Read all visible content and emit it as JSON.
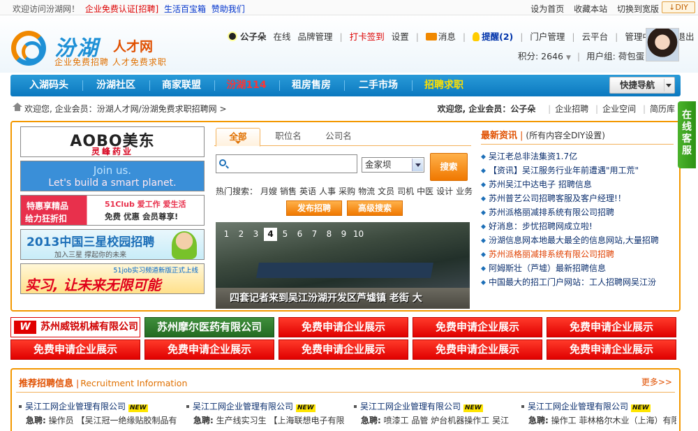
{
  "topbar": {
    "welcome": "欢迎访问汾湖网！",
    "links": [
      "企业免费认证[招聘]",
      "生活百宝箱",
      "赞助我们"
    ],
    "right": [
      "设为首页",
      "收藏本站",
      "切换到宽版"
    ],
    "diy": "↓DIY"
  },
  "logo": {
    "name": "汾湖",
    "sub": "人才网",
    "slogan": "企业免费招聘 人才免费求职"
  },
  "user": {
    "name": "公子朵",
    "status": "在线",
    "manage": "品牌管理",
    "checkin": "打卡签到",
    "settings": "设置",
    "messages": "消息",
    "remind": "提醒(2)",
    "links": [
      "门户管理",
      "云平台",
      "管理中心",
      "退出"
    ],
    "points_label": "积分: 2646",
    "group_label": "用户组: 荷包蛋"
  },
  "nav": {
    "items": [
      "入湖码头",
      "汾湖社区",
      "商家联盟",
      "汾湖114",
      "租房售房",
      "二手市场",
      "招聘求职"
    ],
    "quick": "快捷导航"
  },
  "crumb": {
    "left": "欢迎您, 企业会员：汾湖人才网/汾湖免费求职招聘网 >",
    "right_bold": "欢迎您, 企业会员：公子朵",
    "links": [
      "企业招聘",
      "企业空间",
      "简历库"
    ]
  },
  "banners": {
    "b1_title": "AOBO美东",
    "b1_sub": "灵峰药业",
    "b2_l1": "Join us.",
    "b2_l2": "Let's build a smart planet.",
    "b3_l1": "特惠享精品",
    "b3_l2": "给力狂折扣",
    "b3_brand": "51Club 爱工作 爱生活",
    "b3_l3": "免费 优惠 会员尊享!",
    "b4_title": "2013中国三星校园招聘",
    "b4_sub": "加入三星 撑起你的未来",
    "b5_top": "51job实习频道新版正式上线",
    "b5_title": "实习, 让未来无限可能"
  },
  "search": {
    "tabs": [
      "全部",
      "职位名",
      "公司名"
    ],
    "input_value": "",
    "select_value": "金家坝",
    "button": "搜索",
    "hot_label": "热门搜索：",
    "hot": [
      "月嫂",
      "销售",
      "英语",
      "人事",
      "采购",
      "物流",
      "文员",
      "司机",
      "中医",
      "设计",
      "业务"
    ],
    "post_btn": "发布招聘",
    "adv_btn": "高级搜索"
  },
  "slider": {
    "pages": [
      "1",
      "2",
      "3",
      "4",
      "5",
      "6",
      "7",
      "8",
      "9",
      "10"
    ],
    "active": "4",
    "caption": "四套记者来到吴江汾湖开发区芦墟镇 老街 大"
  },
  "news": {
    "title": "最新资讯",
    "subtitle": "(所有内容全DIY设置)",
    "items": [
      "吴江老总非法集资1.7亿",
      "【资讯】吴江服务行业年前遭遇\"用工荒\"",
      "苏州吴江中达电子 招聘信息",
      "苏州普艺公司招聘客服及客户经理!！",
      "苏州派格丽减排系统有限公司招聘",
      "好消息：步忧招聘网成立啦!",
      "汾湖信息网本地最大最全的信息网站,大量招聘",
      "苏州派格丽减排系统有限公司招聘",
      "阿姆斯壮（芦墟）最新招聘信息",
      "中国最大的招工门户网站：工人招聘网吴江汾"
    ],
    "highlight_index": 7
  },
  "tiles": {
    "row1": [
      "苏州威锐机械有限公司",
      "苏州摩尔医药有限公司",
      "免费申请企业展示",
      "免费申请企业展示",
      "免费申请企业展示"
    ],
    "row2": [
      "免费申请企业展示",
      "免费申请企业展示",
      "免费申请企业展示",
      "免费申请企业展示",
      "免费申请企业展示"
    ],
    "logo_mark": "W"
  },
  "recommend": {
    "title": "推荐招聘信息",
    "title_en": "Recruitment Information",
    "more": "更多>>",
    "new_tag": "NEW",
    "urgent": "急聘:",
    "columns": [
      {
        "company": "吴江工网企业管理有限公司",
        "jobs": "操作员 【吴江冠一绝缘贴胶制品有"
      },
      {
        "company": "吴江工网企业管理有限公司",
        "jobs": "生产线实习生 【上海联想电子有限"
      },
      {
        "company": "吴江工网企业管理有限公司",
        "jobs": "喷漆工 品管 炉台机器操作工 吴江"
      },
      {
        "company": "吴江工网企业管理有限公司",
        "jobs": "操作工 菲林格尔木业（上海）有限"
      }
    ]
  },
  "side": {
    "label": [
      "在",
      "线",
      "客",
      "服"
    ]
  }
}
